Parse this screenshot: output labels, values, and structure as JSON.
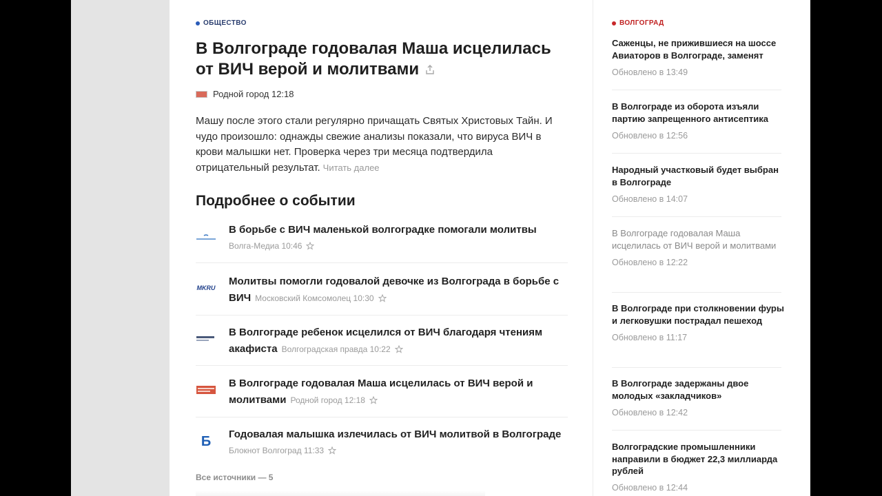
{
  "article": {
    "rubric": "ОБЩЕСТВО",
    "title": "В Волгограде годовалая Маша исцелилась от ВИЧ верой и молитвами",
    "source": "Родной город 12:18",
    "lead": "Машу после этого стали регулярно причащать Святых Христовых Тайн. И чудо произошло: однажды свежие анализы показали, что вируса ВИЧ в крови малышки нет. Проверка через три месяца подтвердила отрицательный результат.",
    "read_more": "Читать далее"
  },
  "related": {
    "heading": "Подробнее о событии",
    "items": [
      {
        "title": "В борьбе с ВИЧ маленькой волгоградке помогали молитвы",
        "meta": "Волга-Медиа 10:46",
        "logo": "volga-media-logo"
      },
      {
        "title": "Молитвы помогли годовалой девочке из Волгограда в борьбе с ВИЧ",
        "meta": "Московский Комсомолец 10:30",
        "logo": "mk-ru-logo",
        "logo_text": "MKRU"
      },
      {
        "title": "В Волгограде ребенок исцелился от ВИЧ благодаря чтениям акафиста",
        "meta": "Волгоградская правда 10:22",
        "logo": "volgogradskaya-pravda-logo"
      },
      {
        "title": "В Волгограде годовалая Маша исцелилась от ВИЧ верой и молитвами",
        "meta": "Родной город 12:18",
        "logo": "rodnoy-gorod-logo"
      },
      {
        "title": "Годовалая малышка излечилась от ВИЧ молитвой в Волгограде",
        "meta": "Блокнот Волгоград 11:33",
        "logo": "bloknot-logo",
        "logo_text": "Б"
      }
    ],
    "all_sources": "Все источники — 5"
  },
  "sidebar": {
    "rubric": "ВОЛГОГРАД",
    "items": [
      {
        "title": "Саженцы, не прижившиеся на шоссе Авиаторов в Волгограде, заменят",
        "updated": "Обновлено в 13:49"
      },
      {
        "title": "В Волгограде из оборота изъяли партию запрещенного антисептика",
        "updated": "Обновлено в 12:56"
      },
      {
        "title": "Народный участковый будет выбран в Волгограде",
        "updated": "Обновлено в 14:07"
      },
      {
        "title": "В Волгограде годовалая Маша исцелилась от ВИЧ верой и молитвами",
        "updated": "Обновлено в 12:22"
      },
      {
        "title": "В Волгограде при столкновении фуры и легковушки пострадал пешеход",
        "updated": "Обновлено в 11:17"
      },
      {
        "title": "В Волгограде задержаны двое молодых «закладчиков»",
        "updated": "Обновлено в 12:42"
      },
      {
        "title": "Волгоградские промышленники направили в бюджет 22,3 миллиарда рублей",
        "updated": "Обновлено в 12:44"
      }
    ]
  },
  "colors": {
    "rubric_blue": "#2a5bb8",
    "rubric_red": "#c8282a",
    "meta_gray": "#9a9a9a"
  }
}
